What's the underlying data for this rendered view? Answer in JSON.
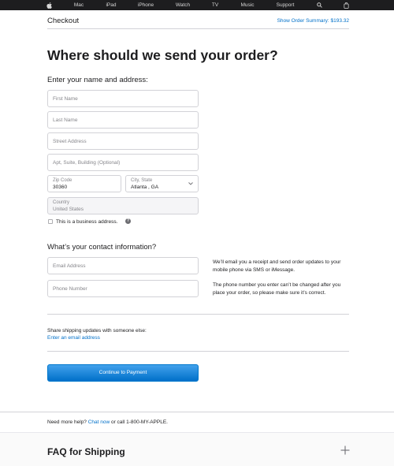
{
  "nav": {
    "items": [
      "Mac",
      "iPad",
      "iPhone",
      "Watch",
      "TV",
      "Music",
      "Support"
    ]
  },
  "header": {
    "title": "Checkout",
    "summary_link": "Show Order Summary: $193.32"
  },
  "page_title": "Where should we send your order?",
  "address": {
    "heading": "Enter your name and address:",
    "first_name_placeholder": "First Name",
    "last_name_placeholder": "Last Name",
    "street_placeholder": "Street Address",
    "apt_placeholder": "Apt, Suite, Building (Optional)",
    "zip_label": "Zip Code",
    "zip_value": "30360",
    "city_label": "City, State",
    "city_value": "Atlanta , GA",
    "country_label": "Country",
    "country_value": "United States",
    "business_label": "This is a business address.",
    "help_symbol": "?"
  },
  "contact": {
    "heading": "What’s your contact information?",
    "email_placeholder": "Email Address",
    "phone_placeholder": "Phone Number",
    "email_note": "We’ll email you a receipt and send order updates to your mobile phone via SMS or iMessage.",
    "phone_note": "The phone number you enter can’t be changed after you place your order, so please make sure it’s correct."
  },
  "share": {
    "text": "Share shipping updates with someone else:",
    "link": "Enter an email address"
  },
  "continue_button": "Continue to Payment",
  "help": {
    "prefix": "Need more help?",
    "chat": "Chat now",
    "suffix": "or call 1-800-MY-APPLE."
  },
  "faq": {
    "title": "FAQ for Shipping"
  },
  "icons": {
    "logo": "apple-logo-icon",
    "search": "search-icon",
    "bag": "bag-icon",
    "dropdown": "chevron-down-icon",
    "expand": "plus-icon"
  },
  "colors": {
    "nav_bg": "#1d1d1f",
    "link": "#0070c9",
    "button": "#0070c9"
  }
}
